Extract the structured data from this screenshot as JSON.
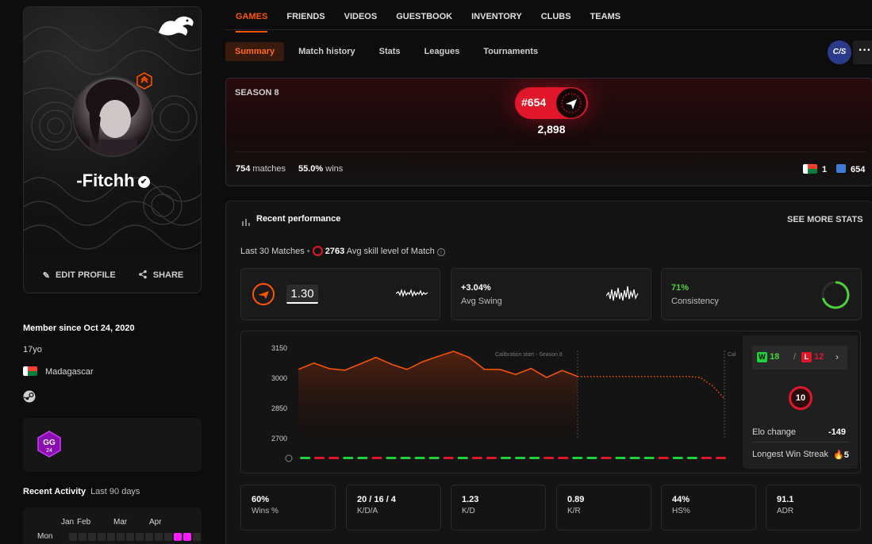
{
  "profile": {
    "nickname": "-Fitchh",
    "edit_label": "EDIT PROFILE",
    "share_label": "SHARE",
    "member_since": "Member since Oct 24, 2020",
    "age": "17yo",
    "country": "Madagascar",
    "recent_activity_title": "Recent Activity",
    "recent_activity_period": "Last 90 days",
    "months": [
      "Jan",
      "Feb",
      "Mar",
      "Apr"
    ],
    "day_label": "Mon"
  },
  "nav": {
    "tabs": [
      "GAMES",
      "FRIENDS",
      "VIDEOS",
      "GUESTBOOK",
      "INVENTORY",
      "CLUBS",
      "TEAMS"
    ],
    "subtabs": [
      "Summary",
      "Match history",
      "Stats",
      "Leagues",
      "Tournaments"
    ],
    "game_badge": "C/S",
    "more": "···"
  },
  "season": {
    "title": "SEASON 8",
    "rank": "#654",
    "elo": "2,898",
    "matches_value": "754",
    "matches_label": "matches",
    "wins_value": "55.0%",
    "wins_label": "wins",
    "country_rank": "1",
    "global_rank": "654"
  },
  "performance": {
    "title": "Recent performance",
    "see_more": "SEE MORE STATS",
    "last_matches": "Last 30 Matches",
    "avg_skill_value": "2763",
    "avg_skill_label": "Avg skill level of Match",
    "rating_value": "1.30",
    "swing_value": "+3.04%",
    "swing_label": "Avg Swing",
    "consistency_value": "71%",
    "consistency_label": "Consistency",
    "consistency_fraction": 0.71,
    "wins": "18",
    "losses": "12",
    "w_label": "W",
    "l_label": "L",
    "level": "10",
    "elo_change_label": "Elo change",
    "elo_change_value": "-149",
    "streak_label": "Longest Win Streak",
    "streak_value": "5",
    "bottom_stats": [
      {
        "value": "60%",
        "label": "Wins %"
      },
      {
        "value": "20 / 16 / 4",
        "label": "K/D/A"
      },
      {
        "value": "1.23",
        "label": "K/D"
      },
      {
        "value": "0.89",
        "label": "K/R"
      },
      {
        "value": "44%",
        "label": "HS%"
      },
      {
        "value": "91.1",
        "label": "ADR"
      }
    ]
  },
  "chart_data": {
    "type": "line",
    "y_ticks": [
      "3150",
      "3000",
      "2850",
      "2700"
    ],
    "ylim": [
      2700,
      3150
    ],
    "annotation": "Calibration start - Season 8",
    "annotation_short": "Cal",
    "series": [
      {
        "values": [
          3040,
          3072,
          3044,
          3036,
          3068,
          3100,
          3066,
          3040,
          3078,
          3105,
          3130,
          3100,
          3040,
          3040,
          3015,
          3045,
          3000,
          3035,
          3005
        ]
      },
      {
        "values": [
          3005,
          3005,
          3005,
          3005,
          3005,
          3005,
          3005,
          3005,
          3005,
          3005,
          3000,
          2960,
          2895
        ]
      }
    ],
    "results": [
      "W",
      "L",
      "L",
      "W",
      "W",
      "L",
      "W",
      "W",
      "W",
      "W",
      "L",
      "W",
      "L",
      "L",
      "W",
      "W",
      "W",
      "L",
      "L",
      "W",
      "W",
      "L",
      "W",
      "W",
      "W",
      "L",
      "W",
      "W",
      "L",
      "L"
    ],
    "colors": {
      "line": "#ff5500",
      "win": "#1fd13a",
      "loss": "#e0172b"
    }
  },
  "colors": {
    "accent": "#ff5500",
    "rank": "#e0172b"
  }
}
